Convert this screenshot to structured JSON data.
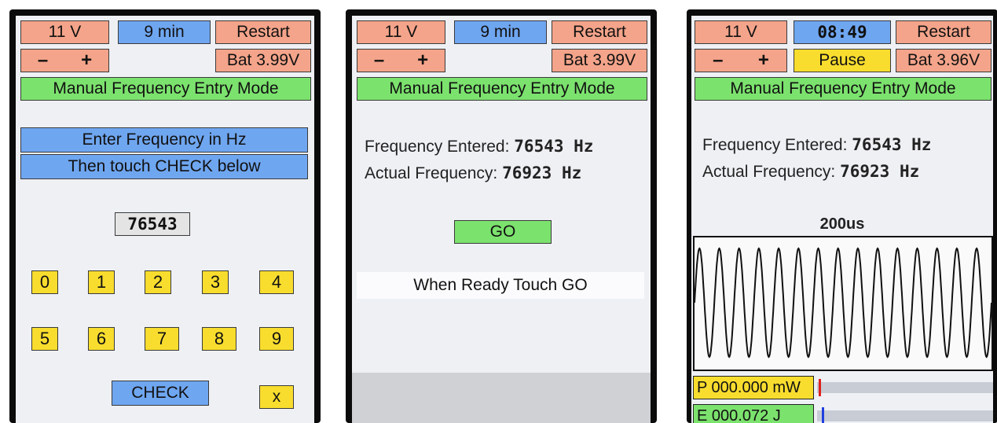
{
  "colors": {
    "salmon": "#f4a48a",
    "blue": "#6fa6f0",
    "green": "#7ce26e",
    "yellow": "#f9dd2e",
    "screen_bg": "#eef0f4",
    "bezel": "#0b0b0b"
  },
  "screen1": {
    "voltage": "11 V",
    "timer": "9 min",
    "restart": "Restart",
    "minus": "–",
    "plus": "+",
    "battery": "Bat 3.99V",
    "mode": "Manual Frequency Entry Mode",
    "instruction1": "Enter Frequency in Hz",
    "instruction2": "Then touch CHECK below",
    "entry_value": "76543",
    "digits_row1": [
      "0",
      "1",
      "2",
      "3",
      "4"
    ],
    "digits_row2": [
      "5",
      "6",
      "7",
      "8",
      "9"
    ],
    "check": "CHECK",
    "cancel": "x"
  },
  "screen2": {
    "voltage": "11 V",
    "timer": "9 min",
    "restart": "Restart",
    "minus": "–",
    "plus": "+",
    "battery": "Bat 3.99V",
    "mode": "Manual Frequency Entry Mode",
    "entered_label": "Frequency Entered:",
    "entered_value": "76543 Hz",
    "actual_label": "Actual Frequency:",
    "actual_value": "76923 Hz",
    "go": "GO",
    "prompt": "When Ready Touch GO"
  },
  "screen3": {
    "voltage": "11 V",
    "time": "08:49",
    "restart": "Restart",
    "minus": "–",
    "plus": "+",
    "pause": "Pause",
    "battery": "Bat 3.96V",
    "mode": "Manual Frequency Entry Mode",
    "entered_label": "Frequency Entered:",
    "entered_value": "76543 Hz",
    "actual_label": "Actual Frequency:",
    "actual_value": "76923 Hz",
    "timebase": "200us",
    "power": "P 000.000 mW",
    "energy": "E 000.072 J",
    "power_level": 0.0,
    "energy_level": 0.02
  }
}
